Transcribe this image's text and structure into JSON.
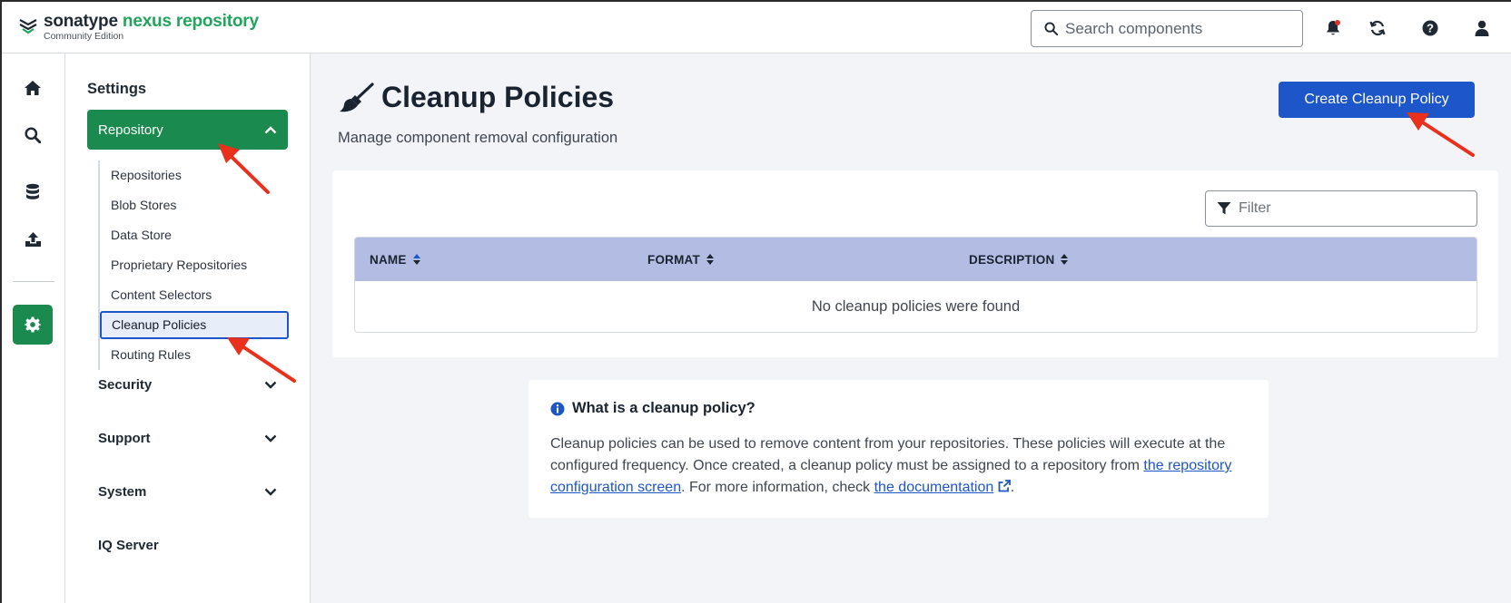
{
  "header": {
    "brand_primary": "sonatype",
    "brand_secondary": "nexus repository",
    "edition": "Community Edition",
    "search_placeholder": "Search components",
    "icons": [
      "bell-icon",
      "refresh-icon",
      "help-icon",
      "user-icon"
    ],
    "notification_dot_color": "#e0312c"
  },
  "rail": {
    "items": [
      "home-icon",
      "search-icon",
      "database-icon",
      "upload-icon",
      "gear-icon"
    ],
    "active": "gear-icon"
  },
  "settings": {
    "title": "Settings",
    "repository": {
      "label": "Repository",
      "items": [
        "Repositories",
        "Blob Stores",
        "Data Store",
        "Proprietary Repositories",
        "Content Selectors",
        "Cleanup Policies",
        "Routing Rules"
      ],
      "selected": "Cleanup Policies"
    },
    "groups": [
      "Security",
      "Support",
      "System"
    ],
    "iq_server": "IQ Server"
  },
  "main": {
    "title": "Cleanup Policies",
    "subtitle": "Manage component removal configuration",
    "create_button": "Create Cleanup Policy",
    "filter_placeholder": "Filter",
    "table": {
      "columns": [
        "NAME",
        "FORMAT",
        "DESCRIPTION"
      ],
      "empty_message": "No cleanup policies were found"
    },
    "info": {
      "title": "What is a cleanup policy?",
      "text_1": "Cleanup policies can be used to remove content from your repositories. These policies will execute at the configured frequency. Once created, a cleanup policy must be assigned to a repository from ",
      "link_1": "the repository configuration screen",
      "text_2": ". For more information, check ",
      "link_2": "the documentation",
      "text_3": "."
    }
  },
  "colors": {
    "brand_green": "#1b8a4e",
    "primary_blue": "#1d56c9",
    "table_header": "#b3bde3",
    "annotation_red": "#e8301c"
  }
}
